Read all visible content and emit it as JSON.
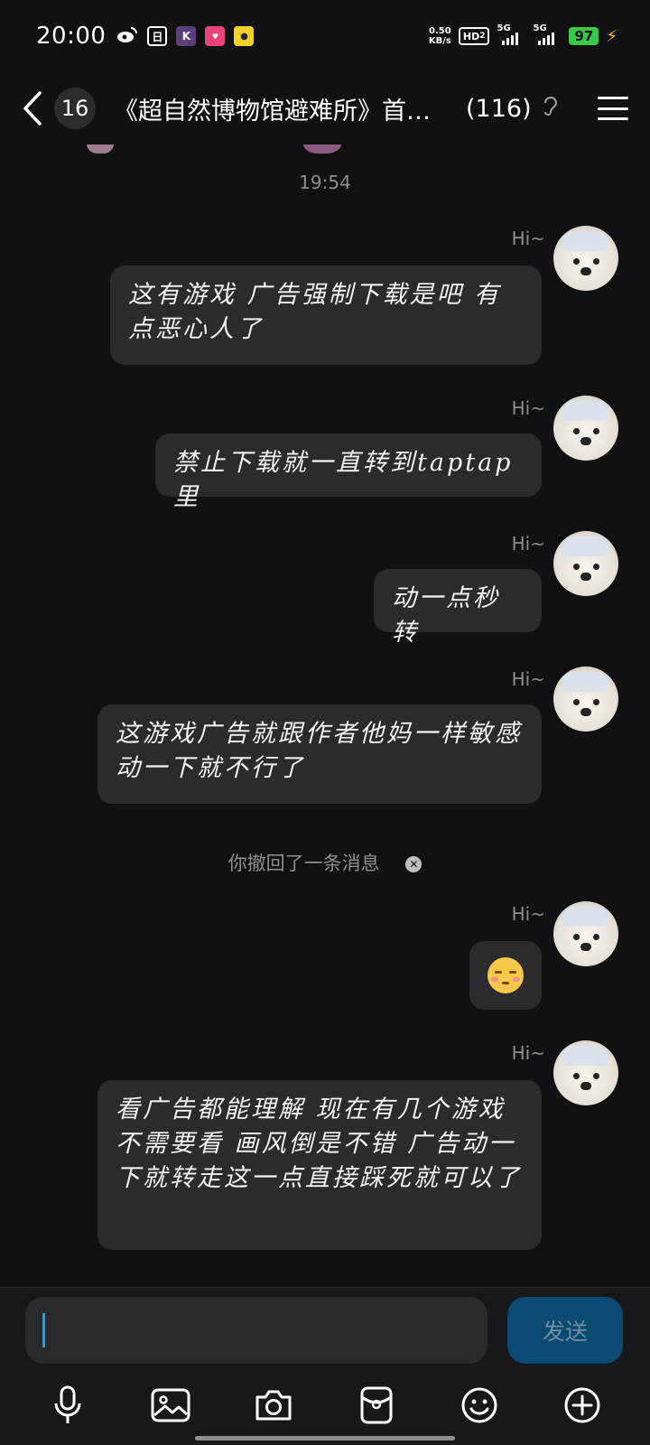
{
  "status_bar": {
    "time": "20:00",
    "net_speed_value": "0.50",
    "net_speed_unit": "KB/s",
    "hd_label": "HD",
    "hd_sub": "2",
    "sim1_label": "5G",
    "sim2_label": "5G",
    "battery": "97",
    "app_icons": [
      "weibo-icon",
      "square-app-icon",
      "k-app-icon",
      "pink-app-icon",
      "yellow-app-icon"
    ]
  },
  "header": {
    "unread_count": "16",
    "title": "《超自然博物馆避难所》首…",
    "member_count": "(116)"
  },
  "chat": {
    "timestamp": "19:54",
    "messages": [
      {
        "nick": "Hi~",
        "text": "这有游戏 广告强制下载是吧 有点恶心人了"
      },
      {
        "nick": "Hi~",
        "text": "禁止下载就一直转到taptap里"
      },
      {
        "nick": "Hi~",
        "text": "动一点秒转"
      },
      {
        "nick": "Hi~",
        "text": "这游戏广告就跟作者他妈一样敏感 动一下就不行了"
      },
      {
        "nick": "Hi~",
        "text": ""
      },
      {
        "nick": "Hi~",
        "text": "看广告都能理解 现在有几个游戏不需要看 画风倒是不错  广告动一下就转走这一点直接踩死就可以了"
      }
    ],
    "recall_notice": "你撤回了一条消息"
  },
  "input": {
    "value": "",
    "send_label": "发送"
  },
  "colors": {
    "background": "#111113",
    "bubble": "#2b2b2e",
    "send_button": "#0b4a73",
    "cursor": "#1aa0e8",
    "battery": "#3cc94a"
  }
}
